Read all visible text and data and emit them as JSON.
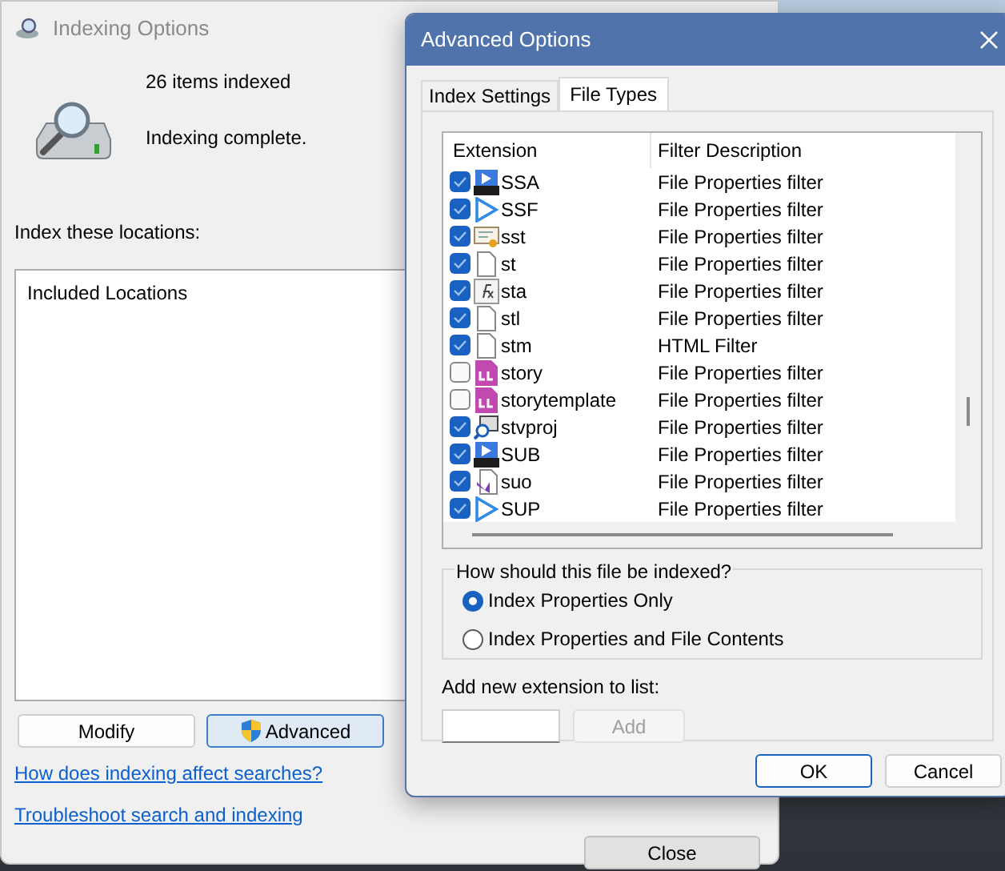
{
  "main_window": {
    "title": "Indexing Options",
    "status_count": "26 items indexed",
    "status_message": "Indexing complete.",
    "locations_label": "Index these locations:",
    "locations_table": {
      "columns": [
        "Included Locations"
      ]
    },
    "buttons": [
      "Modify",
      "Advanced"
    ],
    "links": [
      "How does indexing affect searches?",
      "Troubleshoot search and indexing"
    ],
    "close_button": "Close"
  },
  "dialog": {
    "title": "Advanced Options",
    "tabs": [
      {
        "label": "Index Settings",
        "selected": false
      },
      {
        "label": "File Types",
        "selected": true
      }
    ],
    "file_types": {
      "columns": [
        "Extension",
        "Filter Description"
      ],
      "rows": [
        {
          "extension": "SSA",
          "filter": "File Properties filter",
          "checked": true,
          "kind": "subtitle"
        },
        {
          "extension": "SSF",
          "filter": "File Properties filter",
          "checked": true,
          "kind": "play"
        },
        {
          "extension": "sst",
          "filter": "File Properties filter",
          "checked": true,
          "kind": "certificate"
        },
        {
          "extension": "st",
          "filter": "File Properties filter",
          "checked": true,
          "kind": "blank"
        },
        {
          "extension": "sta",
          "filter": "File Properties filter",
          "checked": true,
          "kind": "formula"
        },
        {
          "extension": "stl",
          "filter": "File Properties filter",
          "checked": true,
          "kind": "blank"
        },
        {
          "extension": "stm",
          "filter": "HTML Filter",
          "checked": true,
          "kind": "blank"
        },
        {
          "extension": "story",
          "filter": "File Properties filter",
          "checked": false,
          "kind": "story"
        },
        {
          "extension": "storytemplate",
          "filter": "File Properties filter",
          "checked": false,
          "kind": "story"
        },
        {
          "extension": "stvproj",
          "filter": "File Properties filter",
          "checked": true,
          "kind": "search"
        },
        {
          "extension": "SUB",
          "filter": "File Properties filter",
          "checked": true,
          "kind": "subtitle"
        },
        {
          "extension": "suo",
          "filter": "File Properties filter",
          "checked": true,
          "kind": "studio"
        },
        {
          "extension": "SUP",
          "filter": "File Properties filter",
          "checked": true,
          "kind": "play"
        }
      ]
    },
    "index_group": {
      "title": "How should this file be indexed?",
      "options": [
        {
          "label": "Index Properties Only",
          "selected": true
        },
        {
          "label": "Index Properties and File Contents",
          "selected": false
        }
      ]
    },
    "add_label": "Add new extension to list:",
    "add_button": {
      "label": "Add",
      "disabled": true
    },
    "buttons": [
      "OK",
      "Cancel"
    ]
  }
}
